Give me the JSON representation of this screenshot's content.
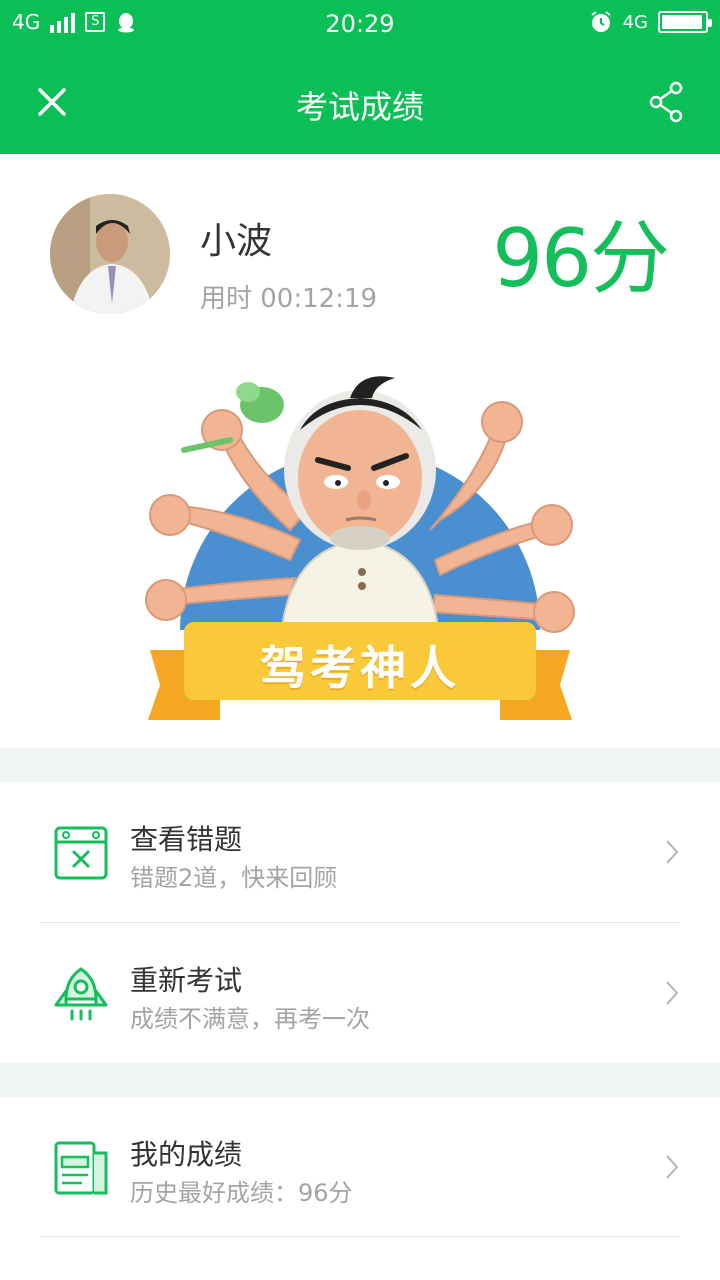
{
  "status_bar": {
    "network_left": "4G",
    "sim_label": "S",
    "time": "20:29",
    "network_right": "4G",
    "battery_level": 0.95
  },
  "header": {
    "title": "考试成绩"
  },
  "profile": {
    "name": "小波",
    "time_used": "用时 00:12:19",
    "score": "96分"
  },
  "badge": {
    "title": "驾考神人"
  },
  "actions": [
    {
      "title": "查看错题",
      "subtitle": "错题2道，快来回顾",
      "icon": "wrong-questions-icon"
    },
    {
      "title": "重新考试",
      "subtitle": "成绩不满意，再考一次",
      "icon": "rocket-icon"
    },
    {
      "title": "我的成绩",
      "subtitle": "历史最好成绩：96分",
      "icon": "report-icon"
    }
  ],
  "colors": {
    "primary": "#0ABF55",
    "score": "#16BE5B",
    "badge_ribbon": "#F9C93A",
    "badge_circle": "#4A8FD0"
  }
}
